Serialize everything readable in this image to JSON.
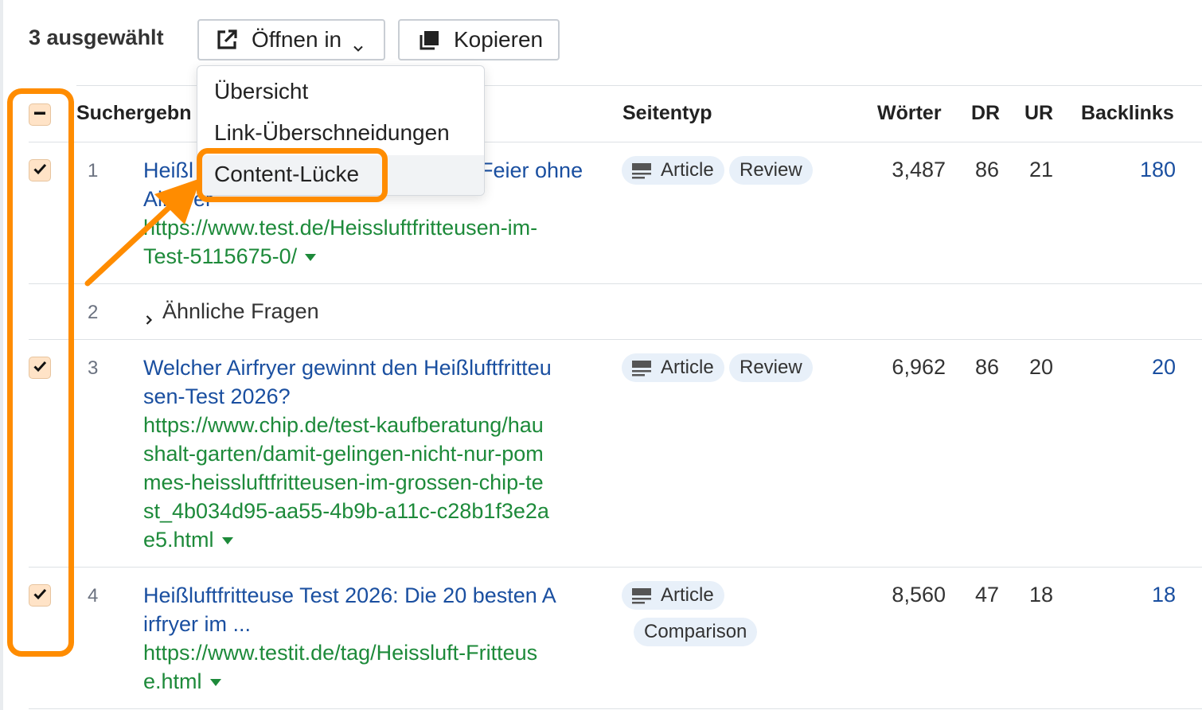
{
  "toolbar": {
    "selected_count": "3 ausgewählt",
    "open_in_label": "Öffnen in",
    "copy_label": "Kopieren"
  },
  "dropdown": {
    "items": [
      {
        "label": "Übersicht"
      },
      {
        "label": "Link-Überschneidungen"
      },
      {
        "label": "Content-Lücke",
        "highlighted": true
      }
    ]
  },
  "table": {
    "headers": {
      "results": "Suchergebn",
      "page_type": "Seitentyp",
      "words": "Wörter",
      "dr": "DR",
      "ur": "UR",
      "backlinks": "Backlinks"
    },
    "rows": [
      {
        "num": "1",
        "checked": true,
        "title_left": "Heißl",
        "title_right": "Feier ohne",
        "title_line2": "Airfryer",
        "url": "https://www.test.de/Heissluftfritteusen-im-\nTest-5115675-0/",
        "badges": [
          "Article",
          "Review"
        ],
        "words": "3,487",
        "dr": "86",
        "ur": "21",
        "backlinks": "180"
      },
      {
        "num": "2",
        "related_label": "Ähnliche Fragen"
      },
      {
        "num": "3",
        "checked": true,
        "title": "Welcher Airfryer gewinnt den Heißluftfritteu\nsen-Test 2026?",
        "url": "https://www.chip.de/test-kaufberatung/hau\nshalt-garten/damit-gelingen-nicht-nur-pom\nmes-heissluftfritteusen-im-grossen-chip-te\nst_4b034d95-aa55-4b9b-a11c-c28b1f3e2a\ne5.html",
        "badges": [
          "Article",
          "Review"
        ],
        "words": "6,962",
        "dr": "86",
        "ur": "20",
        "backlinks": "20"
      },
      {
        "num": "4",
        "checked": true,
        "title": "Heißluftfritteuse Test 2026: Die 20 besten A\nirfryer im ...",
        "url": "https://www.testit.de/tag/Heissluft-Fritteus\ne.html",
        "badges": [
          "Article",
          "Comparison"
        ],
        "words": "8,560",
        "dr": "47",
        "ur": "18",
        "backlinks": "18"
      }
    ]
  },
  "colors": {
    "annotation": "#ff8c00",
    "link_blue": "#1a4fa0",
    "url_green": "#1d8a3a",
    "badge_bg": "#e8f0f9",
    "checkbox_bg": "#ffe3c7"
  },
  "icons": [
    "external-link-icon",
    "chevron-down-icon",
    "copy-icon",
    "checkbox-check-icon",
    "checkbox-indeterminate-icon",
    "article-icon",
    "chevron-right-icon",
    "caret-down-icon"
  ]
}
